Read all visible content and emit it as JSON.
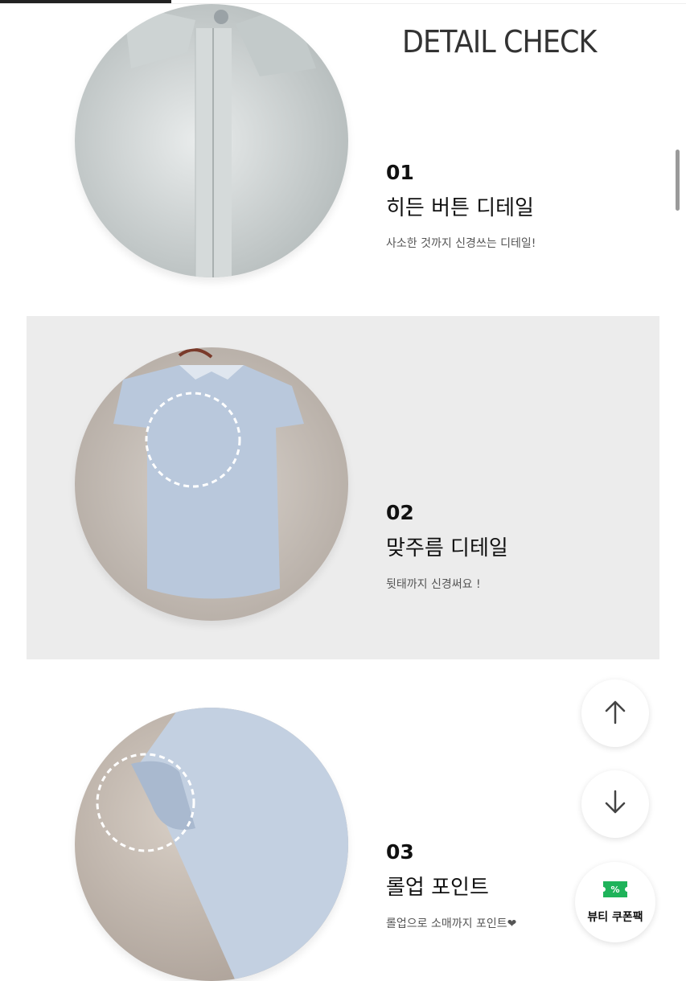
{
  "page": {
    "heading": "DETAIL CHECK"
  },
  "details": [
    {
      "num": "01",
      "title": "히든 버튼 디테일",
      "desc": "사소한 것까지 신경쓰는 디테일!"
    },
    {
      "num": "02",
      "title": "맞주름 디테일",
      "desc": "뒷태까지 신경써요 !"
    },
    {
      "num": "03",
      "title": "롤업 포인트",
      "desc": "롤업으로 소매까지 포인트❤"
    }
  ],
  "floating": {
    "coupon_label": "뷰티 쿠폰팩",
    "up_icon": "arrow-up-icon",
    "down_icon": "arrow-down-icon",
    "coupon_icon": "percent-ticket-icon"
  },
  "colors": {
    "coupon_green": "#1fb35a",
    "section_gray": "#ececec"
  }
}
